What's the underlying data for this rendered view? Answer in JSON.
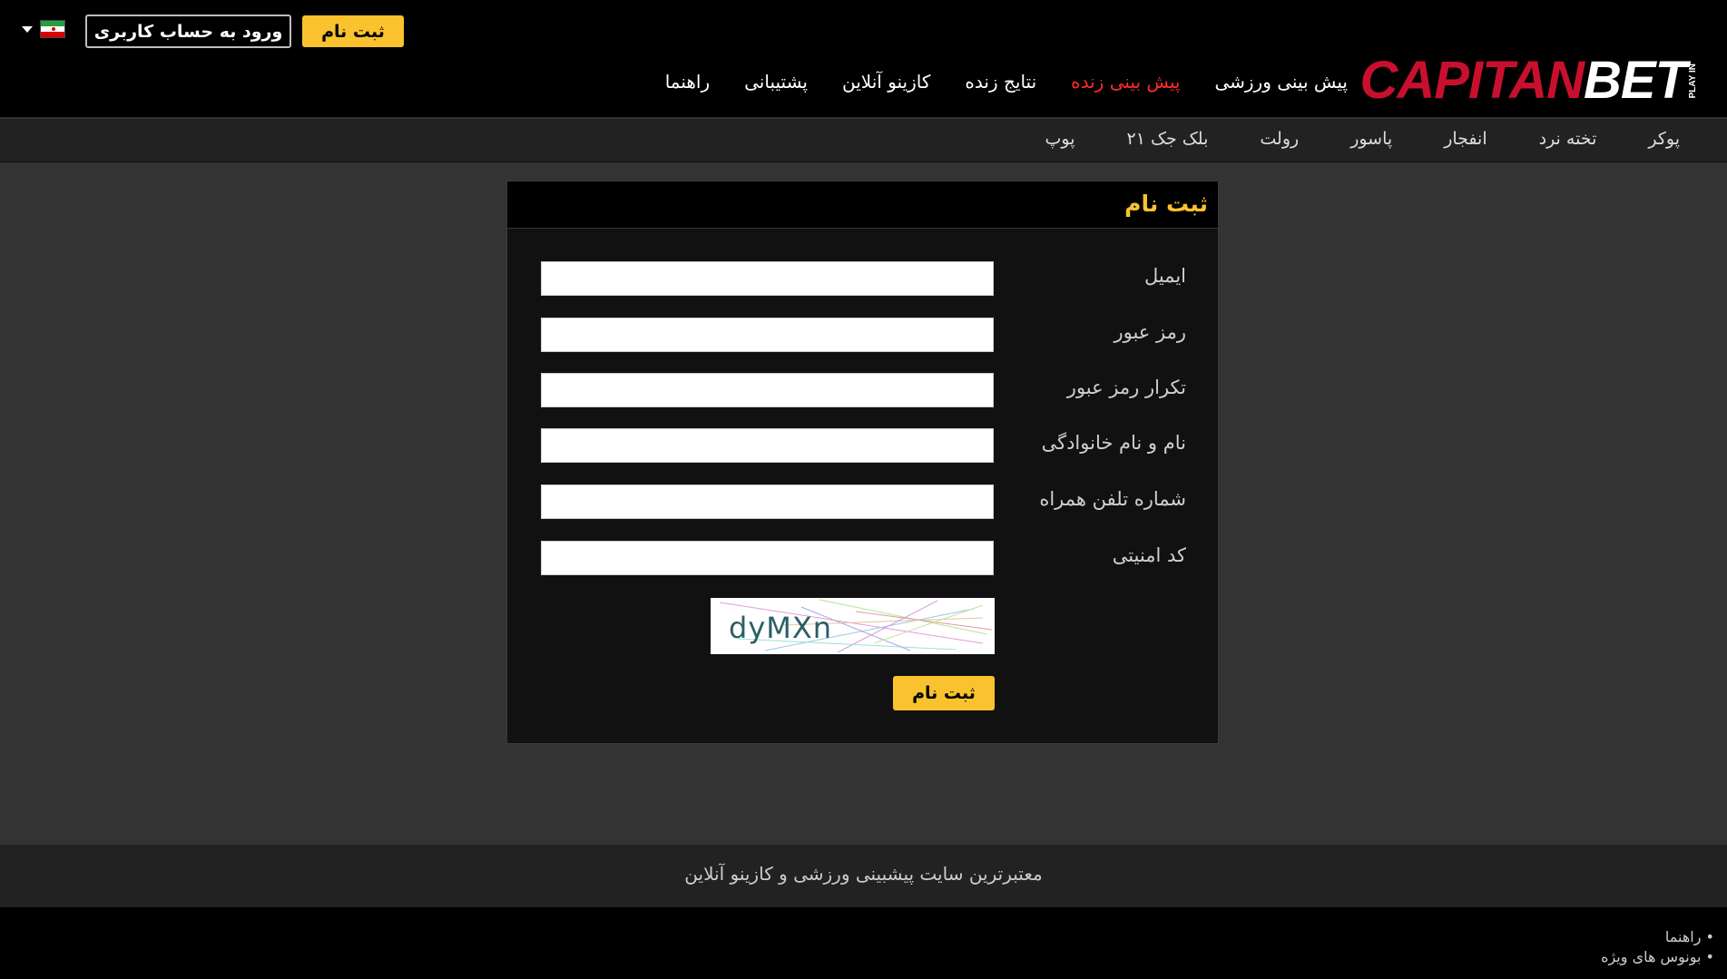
{
  "header": {
    "register_label": "ثبت نام",
    "login_label": "ورود به حساب کاربری",
    "language_flag": "iran-flag-icon",
    "logo": {
      "capitan": "CAPITAN",
      "bet": "BET",
      "tag": "PLAY IN"
    },
    "nav": [
      {
        "label": "پیش بینی ورزشی",
        "active": false
      },
      {
        "label": "پیش بینی زنده",
        "active": true
      },
      {
        "label": "نتایج زنده",
        "active": false
      },
      {
        "label": "کازینو آنلاین",
        "active": false
      },
      {
        "label": "پشتیبانی",
        "active": false
      },
      {
        "label": "راهنما",
        "active": false
      }
    ]
  },
  "subnav": [
    {
      "label": "پوکر"
    },
    {
      "label": "تخته نرد"
    },
    {
      "label": "انفجار"
    },
    {
      "label": "پاسور"
    },
    {
      "label": "رولت"
    },
    {
      "label": "بلک جک ۲۱"
    },
    {
      "label": "پوپ"
    }
  ],
  "form": {
    "title": "ثبت نام",
    "fields": [
      {
        "label": "ایمیل",
        "value": ""
      },
      {
        "label": "رمز عبور",
        "value": ""
      },
      {
        "label": "تکرار رمز عبور",
        "value": ""
      },
      {
        "label": "نام و نام خانوادگی",
        "value": ""
      },
      {
        "label": "شماره تلفن همراه",
        "value": ""
      },
      {
        "label": "کد امنیتی",
        "value": ""
      }
    ],
    "captcha_text": "dyMXn",
    "submit_label": "ثبت نام"
  },
  "footer": {
    "tagline": "معتبرترین سایت پیشبینی ورزشی و کازینو آنلاین",
    "links": [
      "راهنما",
      "بونوس های ویژه"
    ]
  },
  "colors": {
    "accent": "#f9c22e",
    "active_nav": "#ff2a2a",
    "logo_red": "#c8102e",
    "page_bg": "#333333"
  }
}
